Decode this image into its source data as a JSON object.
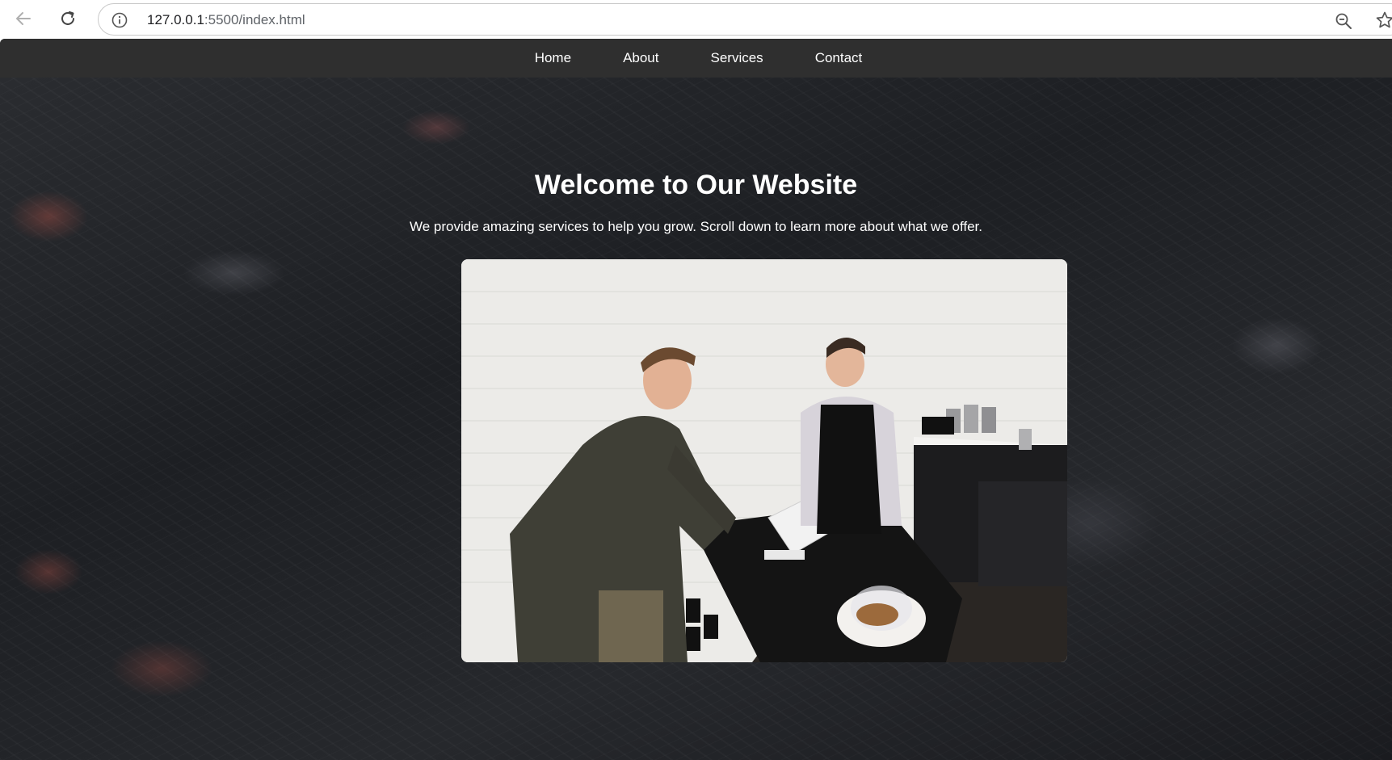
{
  "browser": {
    "url_host": "127.0.0.1",
    "url_path": ":5500/index.html",
    "icons": [
      "back-arrow-icon",
      "reload-icon",
      "info-icon",
      "zoom-out-icon",
      "star-icon"
    ]
  },
  "nav": {
    "items": [
      {
        "label": "Home"
      },
      {
        "label": "About"
      },
      {
        "label": "Services"
      },
      {
        "label": "Contact"
      }
    ],
    "background": "#2f2f2f"
  },
  "hero": {
    "title": "Welcome to Our Website",
    "subtitle": "We provide amazing services to help you grow. Scroll down to learn more about what we offer.",
    "image_alt": "Customer paying at a point-of-sale tablet in a cafe"
  },
  "colors": {
    "text": "#ffffff",
    "hero_overlay": "#1f2024"
  }
}
